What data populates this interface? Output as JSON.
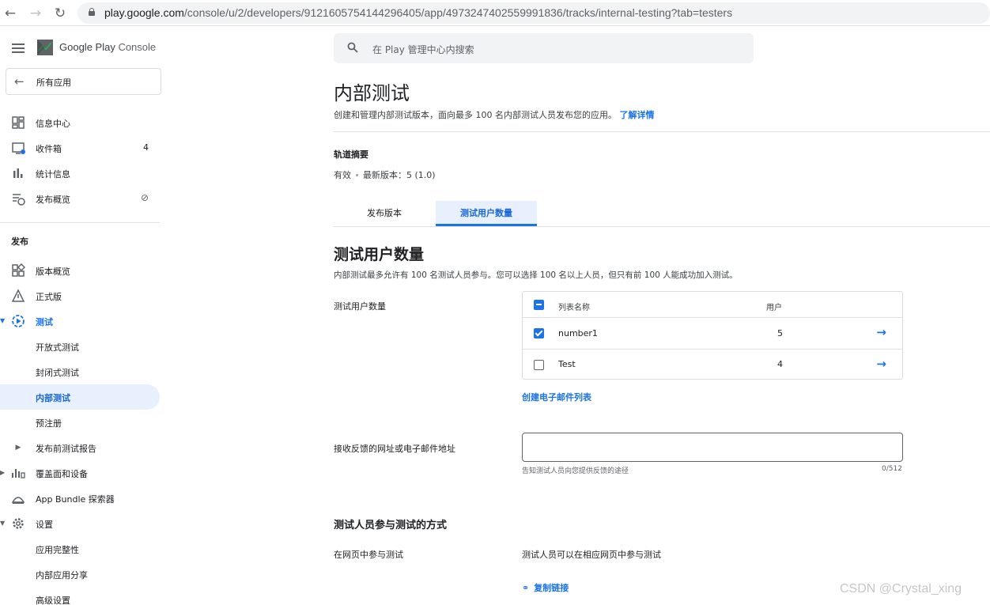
{
  "browser": {
    "url_host": "play.google.com",
    "url_path": "/console/u/2/developers/9121605754144296405/app/4973247402559991836/tracks/internal-testing?tab=testers"
  },
  "sidebar": {
    "logo_text_1": "Google Play",
    "logo_text_2": " Console",
    "all_apps": "所有应用",
    "items": [
      {
        "label": "信息中心",
        "icon": "dashboard-icon"
      },
      {
        "label": "收件箱",
        "icon": "inbox-icon",
        "badge": "4"
      },
      {
        "label": "统计信息",
        "icon": "bar-chart-icon"
      },
      {
        "label": "发布概览",
        "icon": "publishing-overview-icon"
      }
    ],
    "section_release": "发布",
    "release_items": [
      {
        "label": "版本概览",
        "icon": "releases-overview-icon"
      },
      {
        "label": "正式版",
        "icon": "production-icon"
      },
      {
        "label": "测试",
        "icon": "testing-icon"
      },
      {
        "label": "开放式测试"
      },
      {
        "label": "封闭式测试"
      },
      {
        "label": "内部测试"
      },
      {
        "label": "预注册"
      },
      {
        "label": "发布前测试报告"
      },
      {
        "label": "覆盖面和设备",
        "icon": "reach-devices-icon"
      },
      {
        "label": "App Bundle 探索器",
        "icon": "app-bundle-icon"
      },
      {
        "label": "设置",
        "icon": "settings-gear-icon"
      },
      {
        "label": "应用完整性"
      },
      {
        "label": "内部应用分享"
      },
      {
        "label": "高级设置"
      }
    ]
  },
  "search": {
    "placeholder": "在 Play 管理中心内搜索"
  },
  "page": {
    "title": "内部测试",
    "subtitle": "创建和管理内部测试版本，面向最多 100 名内部测试人员发布您的应用。",
    "learn_more": "了解详情",
    "track_summary_heading": "轨道摘要",
    "track_status": "有效",
    "track_latest": "最新版本：5 (1.0)"
  },
  "tabs": [
    {
      "label": "发布版本",
      "active": false
    },
    {
      "label": "测试用户数量",
      "active": true
    }
  ],
  "testers": {
    "title": "测试用户数量",
    "description": "内部测试最多允许有 100 名测试人员参与。您可以选择 100 名以上人员，但只有前 100 人能成功加入测试。",
    "row_label": "测试用户数量",
    "table": {
      "columns": [
        "列表名称",
        "用户"
      ],
      "rows": [
        {
          "name": "number1",
          "users": "5",
          "checked": true
        },
        {
          "name": "Test",
          "users": "4",
          "checked": false
        }
      ]
    },
    "create_list": "创建电子邮件列表",
    "feedback_label": "接收反馈的网址或电子邮件地址",
    "feedback_value": "",
    "feedback_hint": "告知测试人员向您提供反馈的途径",
    "feedback_counter": "0/512"
  },
  "join": {
    "title": "测试人员参与测试的方式",
    "web_label": "在网页中参与测试",
    "web_desc": "测试人员可以在相应网页中参与测试",
    "copy_link": "复制链接"
  },
  "watermark": "CSDN @Crystal_xing",
  "colors": {
    "accent": "#1a73e8",
    "selected_bg": "#e8f0fe"
  }
}
